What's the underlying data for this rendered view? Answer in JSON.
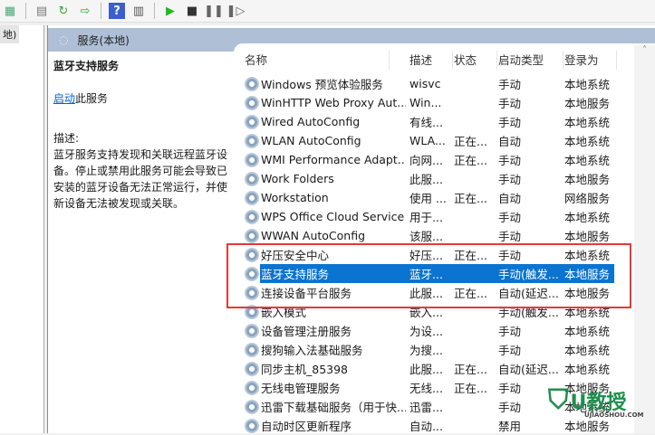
{
  "toolbar": {
    "icons": [
      "properties-icon",
      "refresh-icon",
      "export-icon",
      "help-icon",
      "view-icon",
      "start-icon",
      "stop-icon",
      "pause-icon",
      "resume-icon"
    ]
  },
  "tree": {
    "label": "地)"
  },
  "header": {
    "title": "服务(本地)"
  },
  "desc_panel": {
    "title": "蓝牙支持服务",
    "start_link": "启动",
    "start_suffix": "此服务",
    "desc_label": "描述:",
    "desc_text": "蓝牙服务支持发现和关联远程蓝牙设备。停止或禁用此服务可能会导致已安装的蓝牙设备无法正常运行，并使新设备无法被发现或关联。"
  },
  "columns": [
    "名称",
    "描述",
    "状态",
    "启动类型",
    "登录为"
  ],
  "rows": [
    [
      "Windows 预览体验服务",
      "wisvc",
      "",
      "手动",
      "本地系统"
    ],
    [
      "WinHTTP Web Proxy Aut...",
      "Win...",
      "",
      "手动",
      "本地服务"
    ],
    [
      "Wired AutoConfig",
      "有线...",
      "",
      "手动",
      "本地系统"
    ],
    [
      "WLAN AutoConfig",
      "WLA...",
      "正在...",
      "自动",
      "本地系统"
    ],
    [
      "WMI Performance Adapt...",
      "向网...",
      "正在...",
      "手动",
      "本地系统"
    ],
    [
      "Work Folders",
      "此服...",
      "",
      "手动",
      "本地服务"
    ],
    [
      "Workstation",
      "使用 ...",
      "正在...",
      "自动",
      "网络服务"
    ],
    [
      "WPS Office Cloud Service",
      "用于...",
      "",
      "手动",
      "本地系统"
    ],
    [
      "WWAN AutoConfig",
      "该服...",
      "",
      "手动",
      "本地服务"
    ],
    [
      "好压安全中心",
      "好压...",
      "正在...",
      "手动",
      "本地系统"
    ],
    [
      "蓝牙支持服务",
      "蓝牙...",
      "",
      "手动(触发...",
      "本地服务"
    ],
    [
      "连接设备平台服务",
      "此服...",
      "正在...",
      "自动(延迟...",
      "本地服务"
    ],
    [
      "嵌入模式",
      "嵌入...",
      "",
      "手动(触发...",
      "本地系统"
    ],
    [
      "设备管理注册服务",
      "为设...",
      "",
      "手动",
      "本地系统"
    ],
    [
      "搜狗输入法基础服务",
      "为搜...",
      "",
      "手动",
      "本地系统"
    ],
    [
      "同步主机_85398",
      "此服...",
      "正在...",
      "自动(延迟...",
      "本地系统"
    ],
    [
      "无线电管理服务",
      "无线...",
      "正在...",
      "手动",
      "本地服务"
    ],
    [
      "迅雷下载基础服务（用于快...",
      "迅雷...",
      "",
      "手动",
      "本地系统"
    ],
    [
      "自动时区更新程序",
      "自动...",
      "",
      "禁用",
      "本地服务"
    ]
  ],
  "selected_index": 10,
  "watermark": {
    "text": "U教授",
    "sub": "UJIAOSHOU.COM"
  }
}
